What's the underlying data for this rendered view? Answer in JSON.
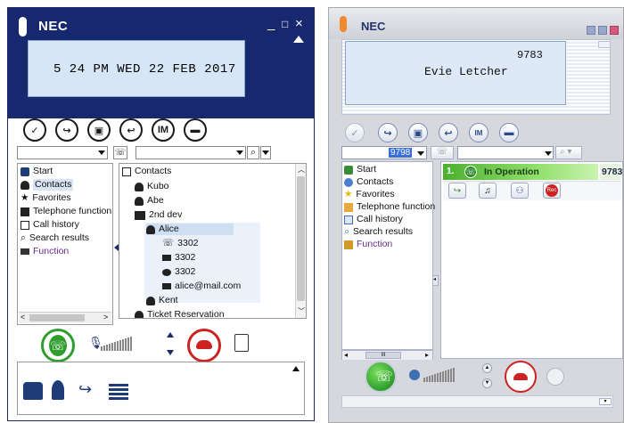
{
  "left_phone": {
    "logo": "NEC",
    "window_controls": [
      "_",
      "□",
      "×"
    ],
    "display_text": "5 24 PM WED 22 FEB 2017",
    "toolbar_icons": [
      "checkmark-icon",
      "call-forward-icon",
      "camera-phone-icon",
      "call-back-icon",
      "im-icon",
      "voicemail-icon"
    ],
    "tree": [
      "Start",
      "Contacts",
      "Favorites",
      "Telephone function",
      "Call history",
      "Search results",
      "Function"
    ],
    "contacts_header": "Contacts",
    "contacts": {
      "kubo": "Kubo",
      "abe": "Abe",
      "group": "2nd dev",
      "alice": "Alice",
      "phone": "3302",
      "im": "3302",
      "chat": "3302",
      "email": "alice@mail.com",
      "kent": "Kent",
      "ticket": "Ticket Reservation"
    }
  },
  "right_phone": {
    "logo": "NEC",
    "display_number": "9783",
    "display_name": "Evie Letcher",
    "line_combo_value": "9798",
    "tree": [
      "Start",
      "Contacts",
      "Favorites",
      "Telephone function",
      "Call history",
      "Search results",
      "Function"
    ],
    "call": {
      "index": "1.",
      "status": "In Operation",
      "number": "9783"
    },
    "scroll_label": "III"
  },
  "colors": {
    "left_title": "#17286e",
    "green": "#2f9e2f",
    "red": "#cc2222",
    "active_call_green": "#6fcf47"
  }
}
